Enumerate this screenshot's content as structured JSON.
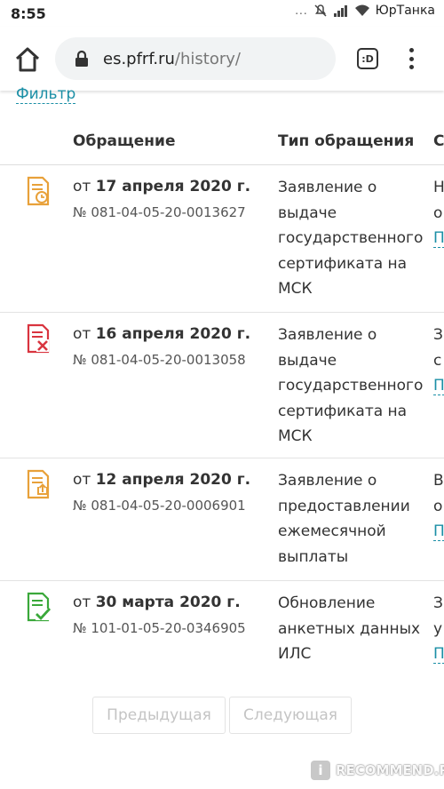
{
  "status_bar": {
    "time": "8:55",
    "dots": "...",
    "carrier": "ЮрТанка"
  },
  "browser": {
    "url_host": "es.pfrf.ru",
    "url_path": "/history/",
    "tabs_label": ":D"
  },
  "filter_label": "Фильтр",
  "table": {
    "headers": [
      "Обращение",
      "Тип обращения",
      "С"
    ],
    "rows": [
      {
        "icon": "document-clock-icon",
        "icon_color": "#e8a13a",
        "date_prefix": "от ",
        "date": "17 апреля 2020 г.",
        "number": "№ 081-04-05-20-0013627",
        "type": "Заявление о выдаче государственного сертификата на МСК",
        "status_lines": [
          "Н",
          "о",
          "П"
        ]
      },
      {
        "icon": "document-cross-icon",
        "icon_color": "#d9343f",
        "date_prefix": "от ",
        "date": "16 апреля 2020 г.",
        "number": "№ 081-04-05-20-0013058",
        "type": "Заявление о выдаче государственного сертификата на МСК",
        "status_lines": [
          "З",
          "с",
          "П"
        ]
      },
      {
        "icon": "document-upload-icon",
        "icon_color": "#e8a13a",
        "date_prefix": "от ",
        "date": "12 апреля 2020 г.",
        "number": "№ 081-04-05-20-0006901",
        "type": "Заявление о предоставлении ежемесячной выплаты",
        "status_lines": [
          "В",
          "о",
          "П"
        ]
      },
      {
        "icon": "document-check-icon",
        "icon_color": "#3aa83a",
        "date_prefix": "от ",
        "date": "30 марта 2020 г.",
        "number": "№ 101-01-05-20-0346905",
        "type": "Обновление анкетных данных ИЛС",
        "status_lines": [
          "З",
          "у",
          "П"
        ]
      }
    ]
  },
  "pagination": {
    "prev_label": "Предыдущая",
    "next_label": "Следующая"
  },
  "watermark": {
    "badge": "i",
    "text": "RECOMMEND.RU"
  }
}
